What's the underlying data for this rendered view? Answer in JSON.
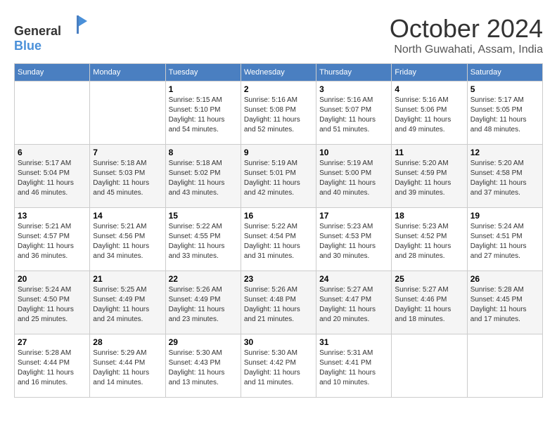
{
  "header": {
    "logo_general": "General",
    "logo_blue": "Blue",
    "month_title": "October 2024",
    "location": "North Guwahati, Assam, India"
  },
  "calendar": {
    "days_of_week": [
      "Sunday",
      "Monday",
      "Tuesday",
      "Wednesday",
      "Thursday",
      "Friday",
      "Saturday"
    ],
    "weeks": [
      [
        {
          "day": "",
          "info": ""
        },
        {
          "day": "",
          "info": ""
        },
        {
          "day": "1",
          "info": "Sunrise: 5:15 AM\nSunset: 5:10 PM\nDaylight: 11 hours and 54 minutes."
        },
        {
          "day": "2",
          "info": "Sunrise: 5:16 AM\nSunset: 5:08 PM\nDaylight: 11 hours and 52 minutes."
        },
        {
          "day": "3",
          "info": "Sunrise: 5:16 AM\nSunset: 5:07 PM\nDaylight: 11 hours and 51 minutes."
        },
        {
          "day": "4",
          "info": "Sunrise: 5:16 AM\nSunset: 5:06 PM\nDaylight: 11 hours and 49 minutes."
        },
        {
          "day": "5",
          "info": "Sunrise: 5:17 AM\nSunset: 5:05 PM\nDaylight: 11 hours and 48 minutes."
        }
      ],
      [
        {
          "day": "6",
          "info": "Sunrise: 5:17 AM\nSunset: 5:04 PM\nDaylight: 11 hours and 46 minutes."
        },
        {
          "day": "7",
          "info": "Sunrise: 5:18 AM\nSunset: 5:03 PM\nDaylight: 11 hours and 45 minutes."
        },
        {
          "day": "8",
          "info": "Sunrise: 5:18 AM\nSunset: 5:02 PM\nDaylight: 11 hours and 43 minutes."
        },
        {
          "day": "9",
          "info": "Sunrise: 5:19 AM\nSunset: 5:01 PM\nDaylight: 11 hours and 42 minutes."
        },
        {
          "day": "10",
          "info": "Sunrise: 5:19 AM\nSunset: 5:00 PM\nDaylight: 11 hours and 40 minutes."
        },
        {
          "day": "11",
          "info": "Sunrise: 5:20 AM\nSunset: 4:59 PM\nDaylight: 11 hours and 39 minutes."
        },
        {
          "day": "12",
          "info": "Sunrise: 5:20 AM\nSunset: 4:58 PM\nDaylight: 11 hours and 37 minutes."
        }
      ],
      [
        {
          "day": "13",
          "info": "Sunrise: 5:21 AM\nSunset: 4:57 PM\nDaylight: 11 hours and 36 minutes."
        },
        {
          "day": "14",
          "info": "Sunrise: 5:21 AM\nSunset: 4:56 PM\nDaylight: 11 hours and 34 minutes."
        },
        {
          "day": "15",
          "info": "Sunrise: 5:22 AM\nSunset: 4:55 PM\nDaylight: 11 hours and 33 minutes."
        },
        {
          "day": "16",
          "info": "Sunrise: 5:22 AM\nSunset: 4:54 PM\nDaylight: 11 hours and 31 minutes."
        },
        {
          "day": "17",
          "info": "Sunrise: 5:23 AM\nSunset: 4:53 PM\nDaylight: 11 hours and 30 minutes."
        },
        {
          "day": "18",
          "info": "Sunrise: 5:23 AM\nSunset: 4:52 PM\nDaylight: 11 hours and 28 minutes."
        },
        {
          "day": "19",
          "info": "Sunrise: 5:24 AM\nSunset: 4:51 PM\nDaylight: 11 hours and 27 minutes."
        }
      ],
      [
        {
          "day": "20",
          "info": "Sunrise: 5:24 AM\nSunset: 4:50 PM\nDaylight: 11 hours and 25 minutes."
        },
        {
          "day": "21",
          "info": "Sunrise: 5:25 AM\nSunset: 4:49 PM\nDaylight: 11 hours and 24 minutes."
        },
        {
          "day": "22",
          "info": "Sunrise: 5:26 AM\nSunset: 4:49 PM\nDaylight: 11 hours and 23 minutes."
        },
        {
          "day": "23",
          "info": "Sunrise: 5:26 AM\nSunset: 4:48 PM\nDaylight: 11 hours and 21 minutes."
        },
        {
          "day": "24",
          "info": "Sunrise: 5:27 AM\nSunset: 4:47 PM\nDaylight: 11 hours and 20 minutes."
        },
        {
          "day": "25",
          "info": "Sunrise: 5:27 AM\nSunset: 4:46 PM\nDaylight: 11 hours and 18 minutes."
        },
        {
          "day": "26",
          "info": "Sunrise: 5:28 AM\nSunset: 4:45 PM\nDaylight: 11 hours and 17 minutes."
        }
      ],
      [
        {
          "day": "27",
          "info": "Sunrise: 5:28 AM\nSunset: 4:44 PM\nDaylight: 11 hours and 16 minutes."
        },
        {
          "day": "28",
          "info": "Sunrise: 5:29 AM\nSunset: 4:44 PM\nDaylight: 11 hours and 14 minutes."
        },
        {
          "day": "29",
          "info": "Sunrise: 5:30 AM\nSunset: 4:43 PM\nDaylight: 11 hours and 13 minutes."
        },
        {
          "day": "30",
          "info": "Sunrise: 5:30 AM\nSunset: 4:42 PM\nDaylight: 11 hours and 11 minutes."
        },
        {
          "day": "31",
          "info": "Sunrise: 5:31 AM\nSunset: 4:41 PM\nDaylight: 11 hours and 10 minutes."
        },
        {
          "day": "",
          "info": ""
        },
        {
          "day": "",
          "info": ""
        }
      ]
    ]
  }
}
